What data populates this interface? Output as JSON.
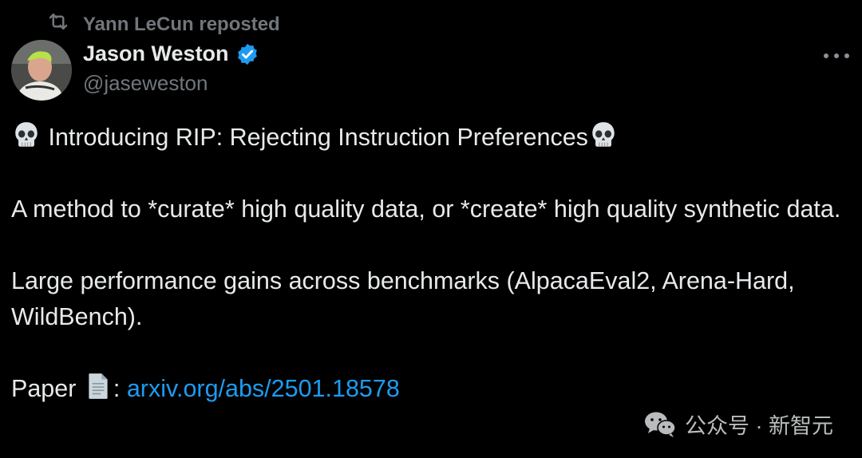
{
  "repost": {
    "text": "Yann LeCun reposted",
    "icon": "repost-icon"
  },
  "author": {
    "display_name": "Jason Weston",
    "handle": "@jaseweston",
    "verified_icon": "verified-badge-icon"
  },
  "tweet": {
    "line1": "Introducing RIP: Rejecting Instruction Preferences",
    "para2": "A method to *curate* high quality data, or *create* high quality synthetic data.",
    "para3": "Large performance gains across benchmarks (AlpacaEval2, Arena-Hard, WildBench).",
    "paper_label": "Paper",
    "paper_sep": ":",
    "paper_link": "arxiv.org/abs/2501.18578"
  },
  "watermark": {
    "text": "公众号 · 新智元"
  },
  "colors": {
    "background": "#000000",
    "text": "#e7e9ea",
    "muted": "#71767b",
    "link": "#1d9bf0",
    "verified": "#1d9bf0"
  }
}
